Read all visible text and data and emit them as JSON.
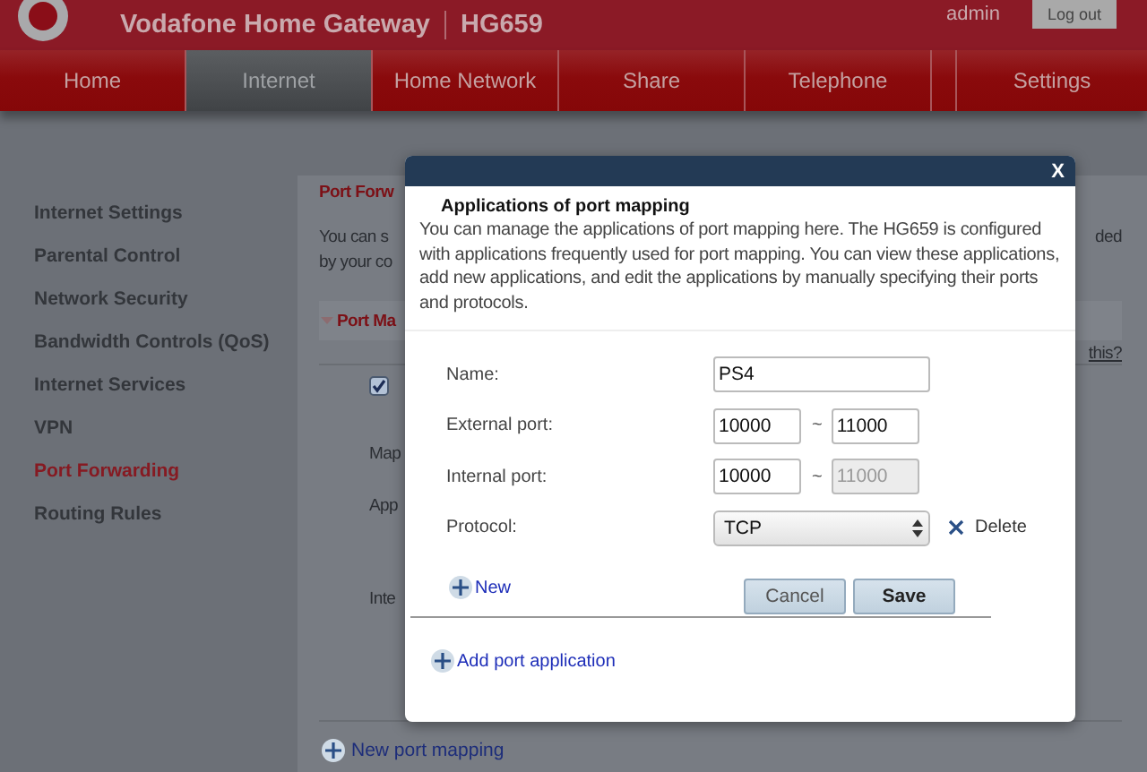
{
  "header": {
    "brand": "Vodafone Home Gateway",
    "model": "HG659",
    "user": "admin",
    "logout": "Log out"
  },
  "nav": [
    {
      "label": "Home",
      "selected": false
    },
    {
      "label": "Internet",
      "selected": true
    },
    {
      "label": "Home Network",
      "selected": false
    },
    {
      "label": "Share",
      "selected": false
    },
    {
      "label": "Telephone",
      "selected": false
    },
    {
      "label": "Settings",
      "selected": false
    }
  ],
  "sidebar": [
    {
      "label": "Internet Settings",
      "selected": false
    },
    {
      "label": "Parental Control",
      "selected": false
    },
    {
      "label": "Network Security",
      "selected": false
    },
    {
      "label": "Bandwidth Controls (QoS)",
      "selected": false
    },
    {
      "label": "Internet Services",
      "selected": false
    },
    {
      "label": "VPN",
      "selected": false
    },
    {
      "label": "Port Forwarding",
      "selected": true
    },
    {
      "label": "Routing Rules",
      "selected": false
    }
  ],
  "background_page": {
    "title": "Port Forw",
    "intro_lines": [
      "You can s",
      "by your co"
    ],
    "intro_end": "ded",
    "section": "Port Ma",
    "help_link": "this?",
    "checkbox_checked": true,
    "labels": [
      "Map",
      "App",
      "Inte"
    ],
    "new_mapping": "New port mapping"
  },
  "dialog": {
    "close": "X",
    "title": "Applications of port mapping",
    "description": "You can manage the applications of port mapping here. The HG659 is configured with applications frequently used for port mapping. You can view these applications, add new applications, and edit the applications by manually specifying their ports and protocols.",
    "fields": [
      {
        "kind": "text",
        "label": "Name:",
        "value": "PS4"
      },
      {
        "kind": "range",
        "label": "External port:",
        "from": "10000",
        "separator": "~",
        "to": "11000",
        "to_disabled": false
      },
      {
        "kind": "range",
        "label": "Internal port:",
        "from": "10000",
        "separator": "~",
        "to": "11000",
        "to_disabled": true
      },
      {
        "kind": "select",
        "label": "Protocol:",
        "value": "TCP",
        "delete": "Delete"
      }
    ],
    "new_link": "New",
    "buttons": [
      {
        "label": "Cancel",
        "kind": "secondary"
      },
      {
        "label": "Save",
        "kind": "primary"
      }
    ],
    "add_link": "Add port application"
  }
}
